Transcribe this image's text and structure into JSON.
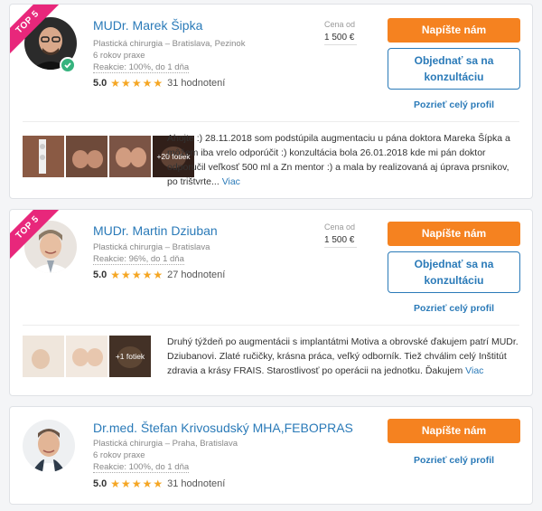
{
  "doctors": [
    {
      "badge": "TOP 5",
      "name": "MUDr. Marek Šipka",
      "specialty": "Plastická chirurgia",
      "location": "Bratislava, Pezinok",
      "experience": "6 rokov praxe",
      "reaction": "Reakcie: 100%, do 1 dňa",
      "score": "5.0",
      "stars": "★★★★★",
      "reviews": "31 hodnotení",
      "price_label": "Cena od",
      "price": "1 500 €",
      "write_button": "Napíšte nám",
      "consult_button": "Objednať sa na konzultáciu",
      "profile_link": "Pozrieť celý profil",
      "photos_more": "+20 fotiek",
      "review": "Ahojte :) 28.11.2018 som podstúpila augmentaciu u pána doktora Mareka Šípka a môžem iba vrelo odporúčit :) konzultácia bola 26.01.2018 kde mi pán doktor odporučil veľkosť 500 ml a Zn mentor :) a mala by realizovaná aj úprava prsnikov, po trištvrte...",
      "review_more": "Viac"
    },
    {
      "badge": "TOP 5",
      "name": "MUDr. Martin Dziuban",
      "specialty": "Plastická chirurgia",
      "location": "Bratislava",
      "reaction": "Reakcie: 96%, do 1 dňa",
      "score": "5.0",
      "stars": "★★★★★",
      "reviews": "27 hodnotení",
      "price_label": "Cena od",
      "price": "1 500 €",
      "write_button": "Napíšte nám",
      "consult_button": "Objednať sa na konzultáciu",
      "profile_link": "Pozrieť celý profil",
      "photos_more": "+1 fotiek",
      "review": "Druhý týždeň po augmentácii s implantátmi Motiva a obrovské ďakujem patrí MUDr. Dziubanovi. Zlaté ručičky, krásna práca, veľký odborník. Tiež chválim celý Inštitút zdravia a krásy FRAIS. Starostlivosť po operácii na jednotku. Ďakujem",
      "review_more": "Viac"
    },
    {
      "name": "Dr.med. Štefan Krivosudský MHA,FEBOPRAS",
      "specialty": "Plastická chirurgia",
      "location": "Praha, Bratislava",
      "experience": "6 rokov praxe",
      "reaction": "Reakcie: 100%, do 1 dňa",
      "score": "5.0",
      "stars": "★★★★★",
      "reviews": "31 hodnotení",
      "write_button": "Napíšte nám",
      "profile_link": "Pozrieť celý profil"
    }
  ]
}
